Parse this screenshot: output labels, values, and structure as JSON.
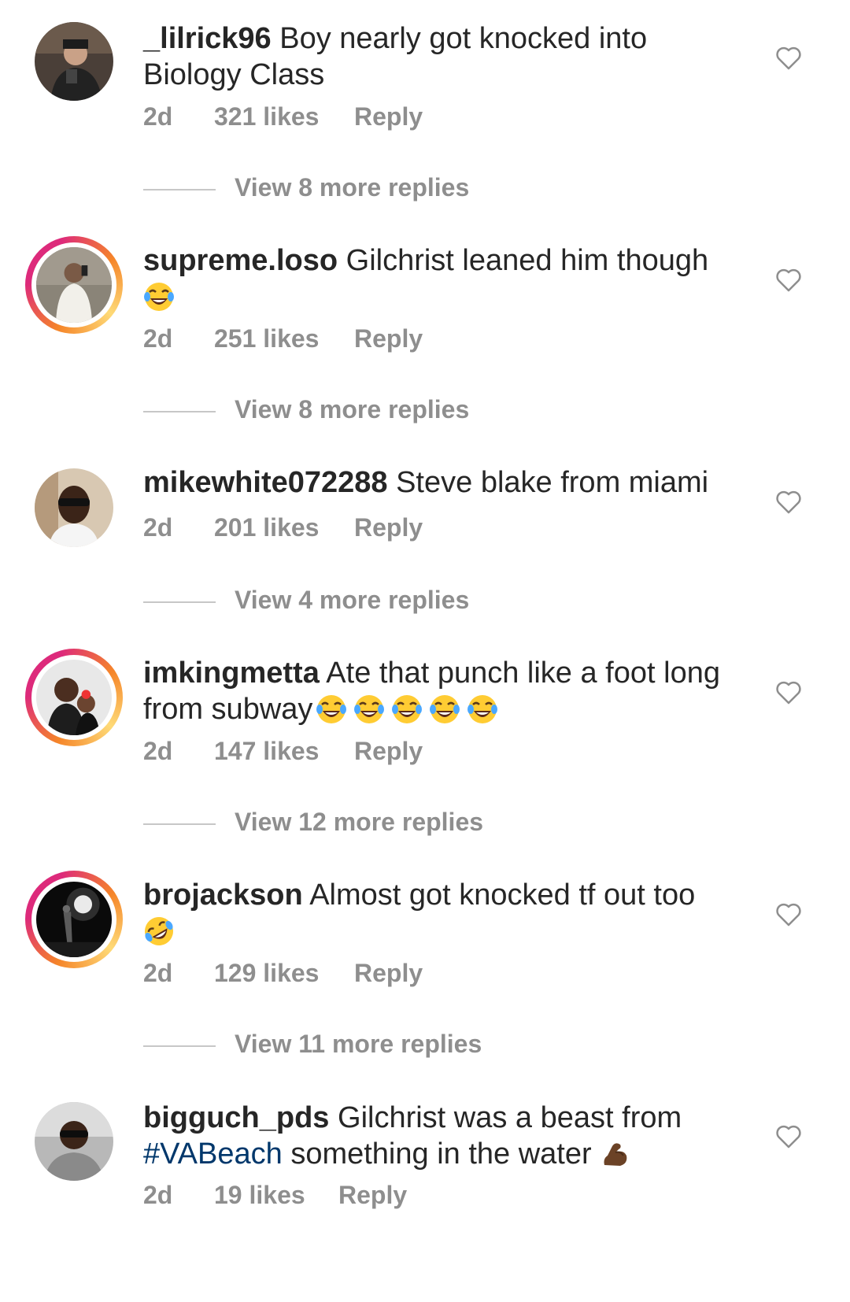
{
  "comments": [
    {
      "username": "_lilrick96",
      "text": " Boy nearly got knocked into Biology Class",
      "age": "2d",
      "likes": "321 likes",
      "reply": "Reply",
      "view_replies": "View 8 more replies"
    },
    {
      "username": "supreme.loso",
      "text": " Gilchrist leaned him though",
      "emoji": [
        "face-with-tears-of-joy"
      ],
      "age": "2d",
      "likes": "251 likes",
      "reply": "Reply",
      "view_replies": "View 8 more replies"
    },
    {
      "username": "mikewhite072288",
      "text": " Steve blake from miami",
      "age": "2d",
      "likes": "201 likes",
      "reply": "Reply",
      "view_replies": "View 4 more replies"
    },
    {
      "username": "imkingmetta",
      "text": " Ate that punch like a foot long from subway",
      "emoji": [
        "face-with-tears-of-joy",
        "face-with-tears-of-joy",
        "face-with-tears-of-joy",
        "face-with-tears-of-joy",
        "face-with-tears-of-joy"
      ],
      "age": "2d",
      "likes": "147 likes",
      "reply": "Reply",
      "view_replies": "View 12 more replies"
    },
    {
      "username": "brojackson",
      "text": " Almost got knocked tf out too",
      "emoji": [
        "rolling-on-the-floor-laughing"
      ],
      "age": "2d",
      "likes": "129 likes",
      "reply": "Reply",
      "view_replies": "View 11 more replies"
    },
    {
      "username": "bigguch_pds",
      "text": " Gilchrist was a beast from",
      "hashtag": "#VABeach",
      "text_after": " something in the water",
      "emoji": [
        "flexed-biceps"
      ],
      "age": "2d",
      "likes": "19 likes",
      "reply": "Reply"
    }
  ],
  "colors": {
    "text": "#262626",
    "secondary": "#8e8e8e",
    "hashtag": "#00376b",
    "story_ring_start": "#f58529",
    "story_ring_end": "#dd2a7b"
  }
}
